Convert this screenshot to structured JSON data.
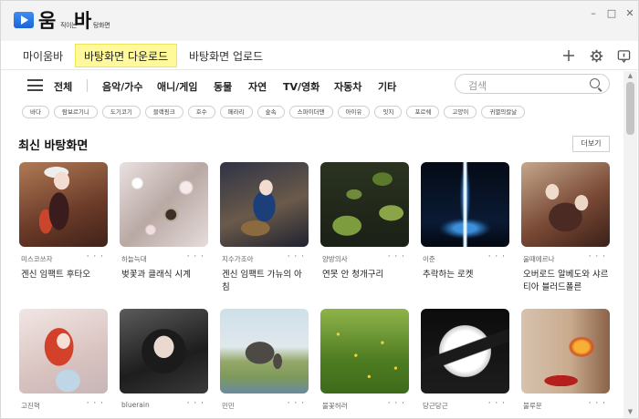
{
  "app": {
    "logo_big": "움",
    "logo_big2": "바",
    "logo_small1": "직이는",
    "logo_small2": "탕화면"
  },
  "window": {
    "minimize": "–",
    "maximize": "□",
    "close": "✕"
  },
  "tabs": [
    {
      "label": "마이움바"
    },
    {
      "label": "바탕화면 다운로드"
    },
    {
      "label": "바탕화면 업로드"
    }
  ],
  "toolbar": {
    "add_icon": "plus-icon",
    "settings_icon": "gear-icon",
    "info_icon": "info-icon"
  },
  "categories": [
    "전체",
    "음악/가수",
    "애니/게임",
    "동물",
    "자연",
    "TV/영화",
    "자동차",
    "기타"
  ],
  "search": {
    "placeholder": "검색"
  },
  "tags": [
    "바다",
    "람보르기니",
    "도기코기",
    "블랙핑크",
    "호수",
    "페라리",
    "숲속",
    "스파이더맨",
    "아이유",
    "잇지",
    "포르쉐",
    "고양이",
    "귀멸의칼날"
  ],
  "section": {
    "title": "최신 바탕화면",
    "more": "더보기"
  },
  "cards": [
    {
      "author": "미스코쓰자",
      "title": "겐신 임팩트 후타오"
    },
    {
      "author": "하늘늑대",
      "title": "벚꽃과 클래식 시계"
    },
    {
      "author": "지수가조아",
      "title": "겐신 임팩트 가뉴의 아침"
    },
    {
      "author": "양방의사",
      "title": "연못 안 청개구리"
    },
    {
      "author": "이준",
      "title": "추락하는 로켓"
    },
    {
      "author": "울때에르나",
      "title": "오버로드 알베도와 샤르티아 블러드폴른"
    },
    {
      "author": "고진혁",
      "title": ""
    },
    {
      "author": "bluerain",
      "title": ""
    },
    {
      "author": "민민",
      "title": ""
    },
    {
      "author": "불꽃허러",
      "title": ""
    },
    {
      "author": "당근당근",
      "title": ""
    },
    {
      "author": "불루문",
      "title": ""
    }
  ],
  "card_menu": "· · ·",
  "colors": {
    "active_tab": "#fff99c",
    "accent": "#2a6fe0"
  }
}
